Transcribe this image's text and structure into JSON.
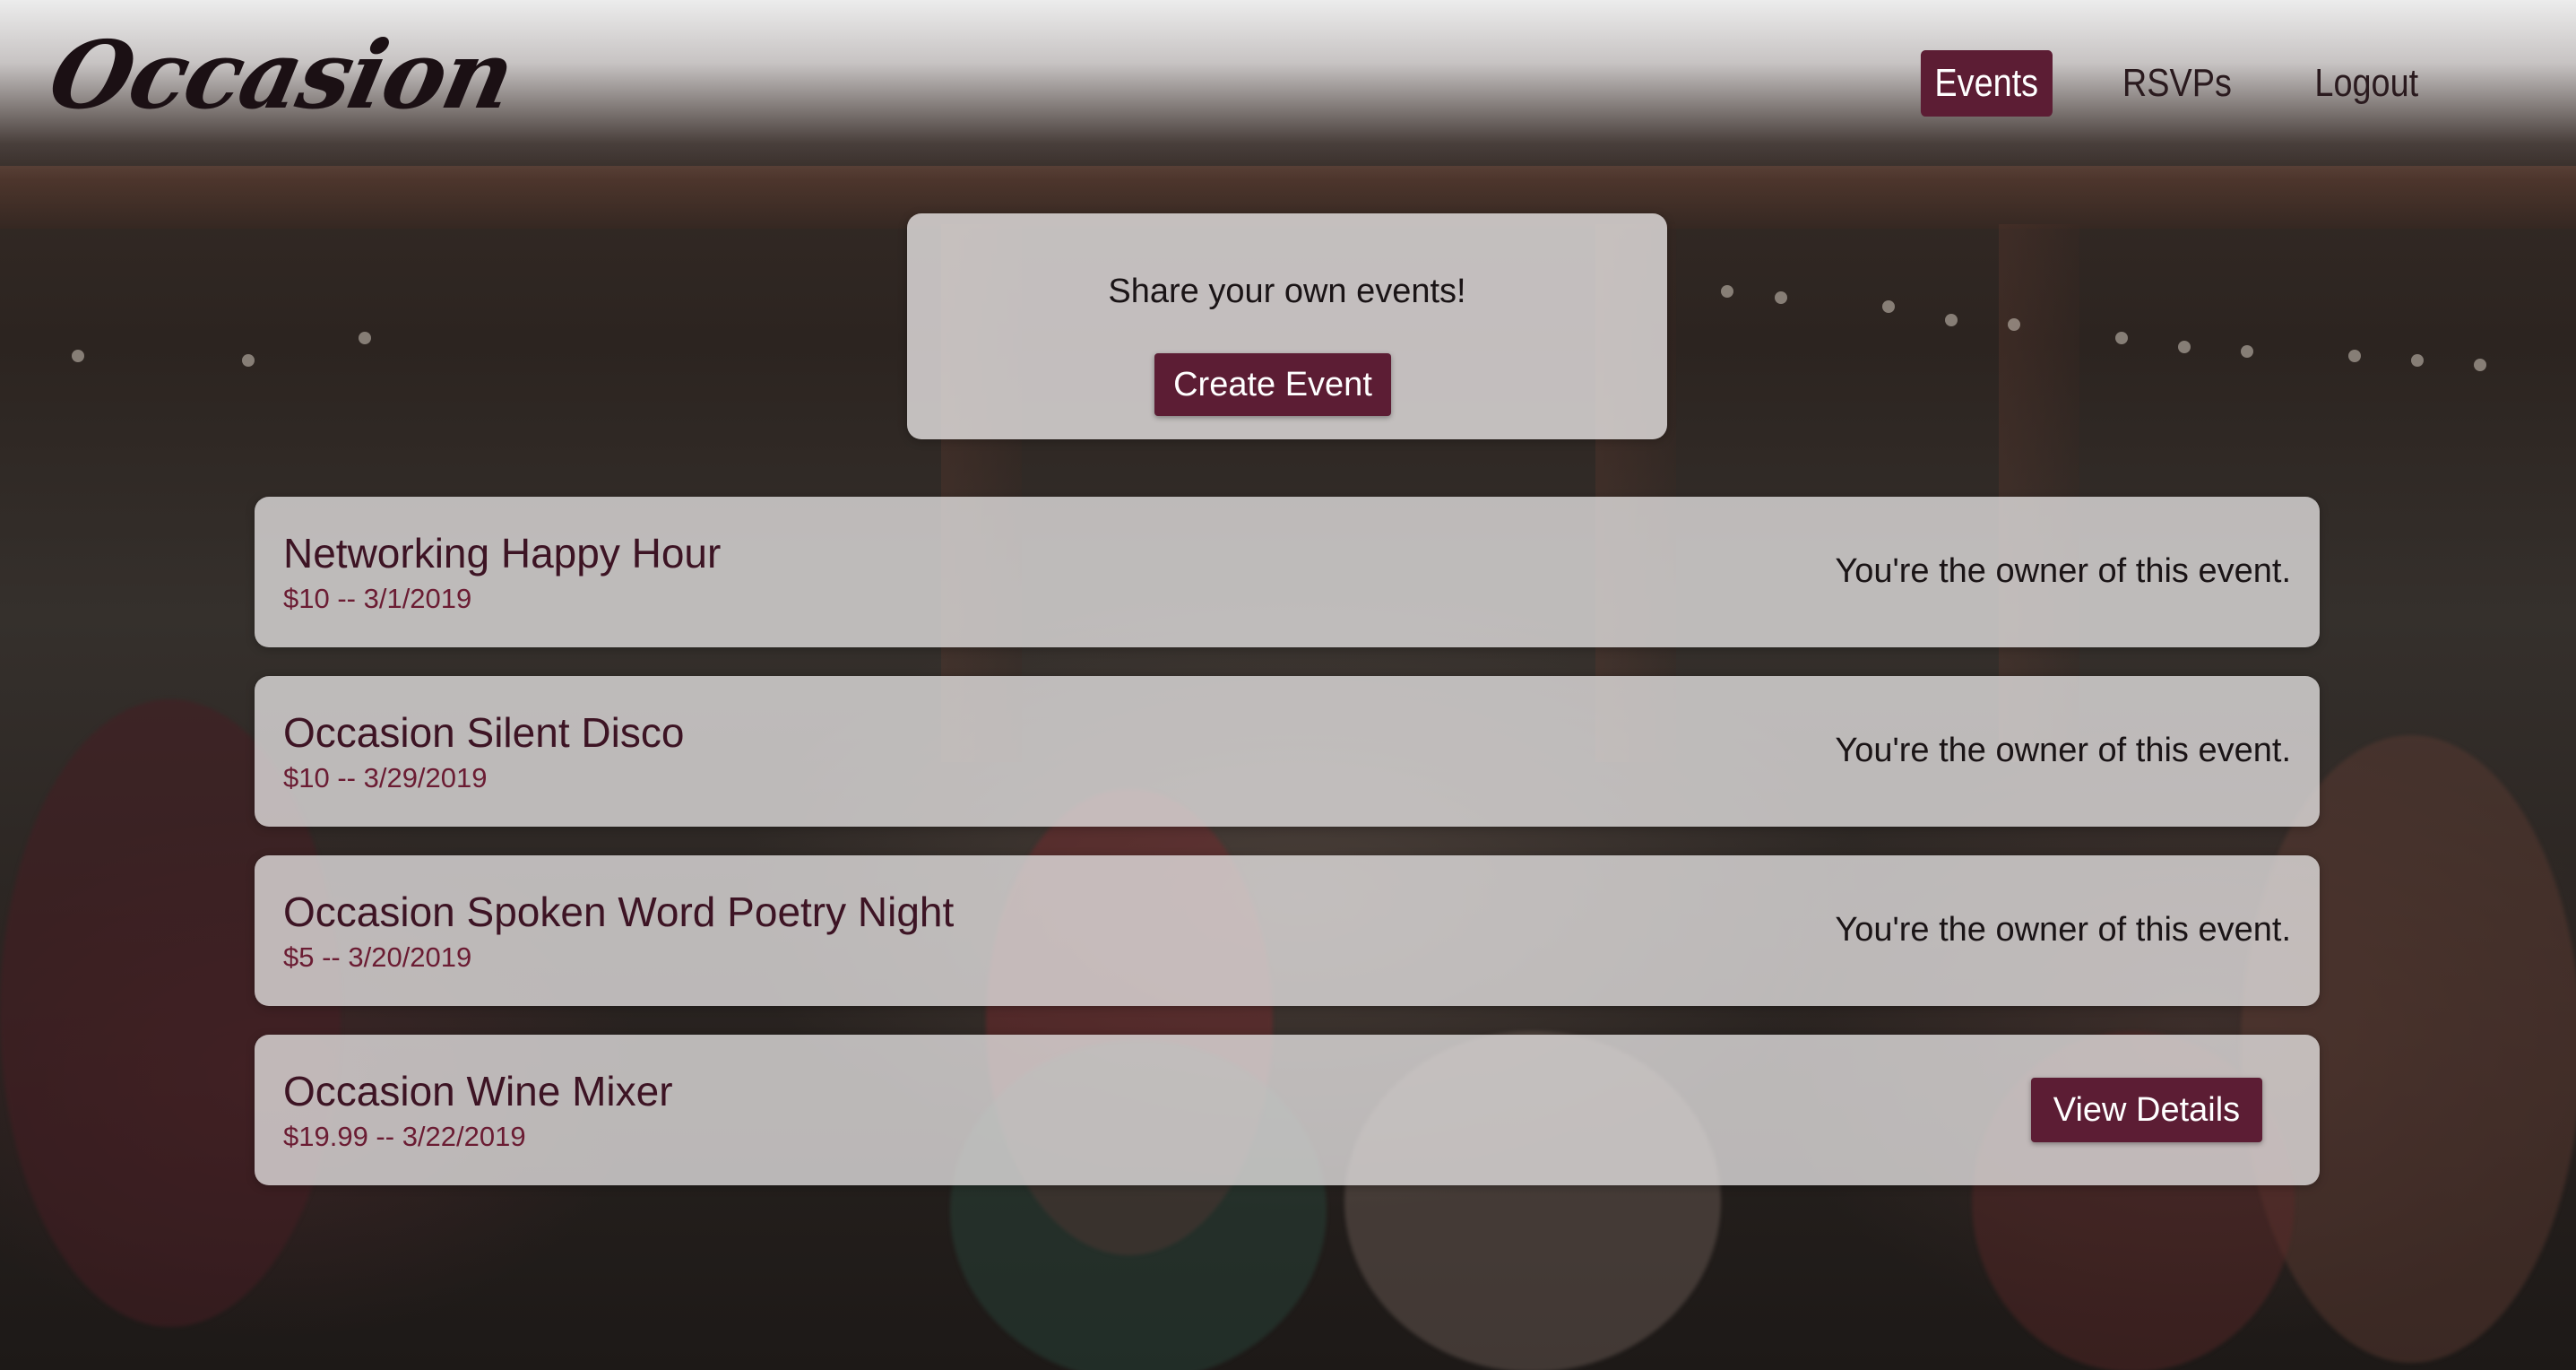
{
  "app": {
    "logo": "Occasion"
  },
  "nav": {
    "items": [
      {
        "label": "Events",
        "active": true
      },
      {
        "label": "RSVPs",
        "active": false
      },
      {
        "label": "Logout",
        "active": false
      }
    ]
  },
  "share": {
    "text": "Share your own events!",
    "button_label": "Create Event"
  },
  "events": [
    {
      "title": "Networking Happy Hour",
      "meta": "$10 -- 3/1/2019",
      "status": "You're the owner of this event."
    },
    {
      "title": "Occasion Silent Disco",
      "meta": "$10 -- 3/29/2019",
      "status": "You're the owner of this event."
    },
    {
      "title": "Occasion Spoken Word Poetry Night",
      "meta": "$5 -- 3/20/2019",
      "status": "You're the owner of this event."
    },
    {
      "title": "Occasion Wine Mixer",
      "meta": "$19.99 -- 3/22/2019",
      "action_label": "View Details"
    }
  ],
  "colors": {
    "accent": "#5c1d34",
    "title_text": "#3d1424",
    "meta_text": "#6b1c33",
    "card_bg": "#e6e3e3"
  }
}
